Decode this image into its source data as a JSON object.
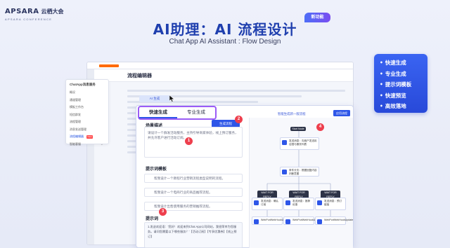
{
  "brand": {
    "name": "APSARA",
    "name_cn": "云栖大会",
    "sub": "APSARA CONFERENCE"
  },
  "header": {
    "title": "AI助理：AI 流程设计",
    "badge": "新功能",
    "subtitle": "Chat App AI Assistant : Flow Design"
  },
  "features": [
    "快速生成",
    "专业生成",
    "提示词模板",
    "快速预览",
    "高效落地"
  ],
  "console": {
    "title": "流程编辑器"
  },
  "menu": {
    "header": "ChatApp消息服务",
    "items": [
      "概况",
      "通道管理",
      "模板工作台",
      "短信群发",
      "流程管理",
      "消息发送管理",
      "流程编辑器",
      "智能客服"
    ],
    "new_badge": "New"
  },
  "mini_tab": "AI 生成",
  "tabs": {
    "quick": "快速生成",
    "pro": "专业生成"
  },
  "scene": {
    "label": "场景描述",
    "text": "请设计一个群发活动服务，主持引导商家体验，线上预订服务，并允许客户进行活动订阅。"
  },
  "generate_btn": "生成流程",
  "template": {
    "label": "提示词模板",
    "items": [
      "帮我设计一个教程行业营销流程类型说明的流程。",
      "帮我设计一个电商行业的商品推荐流程。",
      "帮我设计出售使用服务的营销推荐流程。"
    ]
  },
  "prompt": {
    "label": "提示词",
    "text": "1.发送欢迎语：'您好！欢迎来到Chat App公司网站，我很荣幸为您服务。请问您需要以下哪些服务？'【活动订阅】【专享优惠券】【线上预订】"
  },
  "flow": {
    "header": "智能生成新一版流程",
    "button": "应用流程",
    "start": "Start Node",
    "nodes": [
      "发送消息：向用户发送欢迎语与服务列表",
      "条件分支：根据回复内容判断意图",
      "发送消息：确认订阅",
      "发送消息：推荐优惠",
      "发送消息：预订链接",
      "WebPortWebHookUpdate",
      "WebPortWebHookUpdate",
      "WebPortWebHookUpdate"
    ],
    "pills": [
      "WAIT FOR REPLY",
      "WAIT FOR REPLY",
      "WAIT FOR REPLY"
    ]
  },
  "markers": [
    "1",
    "2",
    "3",
    "4"
  ]
}
